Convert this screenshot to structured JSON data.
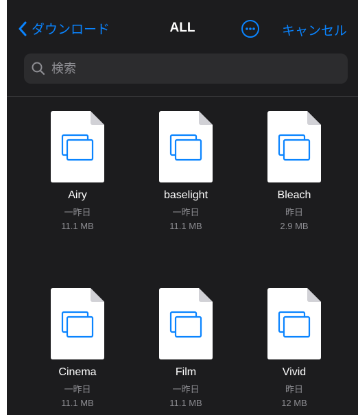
{
  "nav": {
    "back_label": "ダウンロード",
    "title": "ALL",
    "cancel_label": "キャンセル"
  },
  "search": {
    "placeholder": "検索"
  },
  "files": [
    {
      "name": "Airy",
      "date": "一昨日",
      "size": "11.1 MB"
    },
    {
      "name": "baselight",
      "date": "一昨日",
      "size": "11.1 MB"
    },
    {
      "name": "Bleach",
      "date": "昨日",
      "size": "2.9 MB"
    },
    {
      "name": "Cinema",
      "date": "一昨日",
      "size": "11.1 MB"
    },
    {
      "name": "Film",
      "date": "一昨日",
      "size": "11.1 MB"
    },
    {
      "name": "Vivid",
      "date": "昨日",
      "size": "12 MB"
    }
  ],
  "colors": {
    "accent": "#0a84ff",
    "background": "#1c1c1e",
    "secondary_text": "#8e8e93"
  },
  "icons": {
    "back": "chevron-left-icon",
    "more": "ellipsis-circle-icon",
    "search": "magnifying-glass-icon",
    "file": "stacked-windows-document-icon"
  }
}
